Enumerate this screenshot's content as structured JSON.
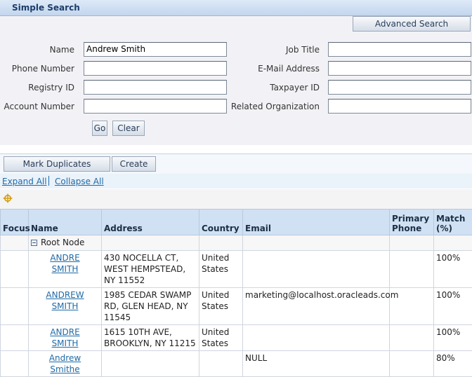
{
  "section": {
    "title": "Simple Search"
  },
  "buttons": {
    "advanced": "Advanced Search",
    "go": "Go",
    "clear": "Clear",
    "mark_duplicates": "Mark Duplicates",
    "create": "Create"
  },
  "form": {
    "name_label": "Name",
    "name_value": "Andrew Smith",
    "phone_label": "Phone Number",
    "phone_value": "",
    "registry_label": "Registry ID",
    "registry_value": "",
    "account_label": "Account Number",
    "account_value": "",
    "job_label": "Job Title",
    "job_value": "",
    "email_label": "E-Mail Address",
    "email_value": "",
    "taxpayer_label": "Taxpayer ID",
    "taxpayer_value": "",
    "related_label": "Related Organization",
    "related_value": ""
  },
  "links": {
    "expand": "Expand All",
    "collapse": "Collapse All"
  },
  "icons": {
    "focus": "focus-target-icon",
    "collapse": "minus-square-icon"
  },
  "table": {
    "headers": {
      "focus": "Focus",
      "name": "Name",
      "address": "Address",
      "country": "Country",
      "email": "Email",
      "phone": "Primary Phone",
      "match": "Match (%)"
    },
    "root_label": "Root Node",
    "rows": [
      {
        "name": "ANDRE SMITH",
        "address": "430 NOCELLA CT, WEST HEMPSTEAD, NY 11552",
        "country": "United States",
        "email": "",
        "phone": "",
        "match": "100%"
      },
      {
        "name": "ANDREW SMITH",
        "address": "1985 CEDAR SWAMP RD, GLEN HEAD, NY 11545",
        "country": "United States",
        "email": "marketing@localhost.oracleads.com",
        "phone": "",
        "match": "100%"
      },
      {
        "name": "ANDRE SMITH",
        "address": "1615 10TH AVE, BROOKLYN, NY 11215",
        "country": "United States",
        "email": "",
        "phone": "",
        "match": "100%"
      },
      {
        "name": "Andrew Smithe",
        "address": "",
        "country": "",
        "email": "NULL",
        "phone": "",
        "match": "80%"
      }
    ]
  }
}
